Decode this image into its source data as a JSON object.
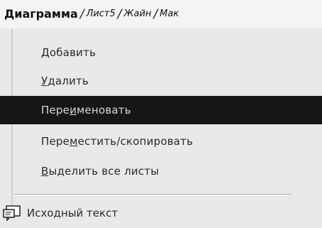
{
  "tabs": [
    {
      "label": "Диаграмма",
      "active": true
    },
    {
      "label": "Лист5",
      "active": false
    },
    {
      "label": "Жайн",
      "active": false
    },
    {
      "label": "Мак",
      "active": false
    }
  ],
  "menu": {
    "items": [
      {
        "pre": "",
        "mnemonic": "Д",
        "post": "обавить",
        "selected": false
      },
      {
        "pre": "",
        "mnemonic": "У",
        "post": "далить",
        "selected": false
      },
      {
        "pre": "Пере",
        "mnemonic": "и",
        "post": "меновать",
        "selected": true
      },
      {
        "pre": "Пере",
        "mnemonic": "м",
        "post": "естить/скопировать",
        "selected": false
      },
      {
        "pre": "",
        "mnemonic": "В",
        "post": "ыделить все листы",
        "selected": false
      }
    ],
    "source_label": "Исходный текст",
    "source_icon": "source-code-icon"
  },
  "colors": {
    "highlight": "#161616",
    "menu_bg": "#e9e9e9"
  }
}
